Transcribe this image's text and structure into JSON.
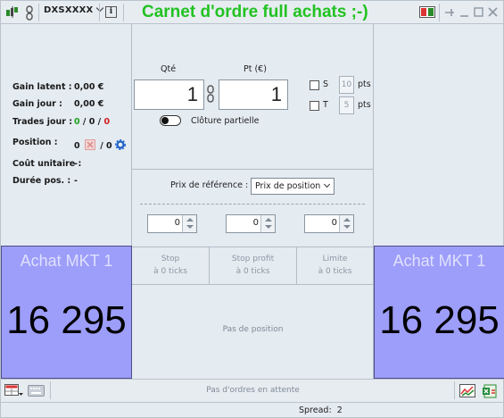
{
  "header": {
    "instrument": "DXSXXXX",
    "title": "Carnet d'ordre full achats ;-)",
    "info_glyph": "i",
    "icons": [
      "chart-icon",
      "link-icon",
      "info-icon",
      "layout-icon",
      "pin-icon",
      "minimize-icon",
      "maximize-icon",
      "close-icon"
    ]
  },
  "stats": [
    {
      "label": "Gain latent :",
      "value": "0,00 €"
    },
    {
      "label": "Gain jour :",
      "value": "0,00 €"
    },
    {
      "label": "Trades jour :",
      "value_a": "0",
      "value_b": "0",
      "value_c": "0"
    },
    {
      "label": "Position :",
      "value": "0",
      "value_b": "0"
    },
    {
      "label": "Coût unitaire :",
      "value": "-"
    },
    {
      "label": "Durée pos. :",
      "value": "-"
    }
  ],
  "order_entry": {
    "qty_label": "Qté",
    "qty_value": "1",
    "pt_label": "Pt (€)",
    "pt_value": "1",
    "s_label": "S",
    "s_pts": "10",
    "t_label": "T",
    "t_pts": "5",
    "pts_unit": "pts",
    "partial_close_label": "Clôture partielle"
  },
  "reference": {
    "label": "Prix de référence :",
    "selected": "Prix de position"
  },
  "spinners": [
    "0",
    "0",
    "0"
  ],
  "sub_headers": [
    {
      "line1": "Stop",
      "line2": "à 0 ticks"
    },
    {
      "line1": "Stop profit",
      "line2": "à 0 ticks"
    },
    {
      "line1": "Limite",
      "line2": "à 0 ticks"
    }
  ],
  "no_position_text": "Pas de position",
  "buy_left": {
    "caption": "Achat MKT 1",
    "price": "16 295"
  },
  "buy_right": {
    "caption": "Achat MKT 1",
    "price": "16 295"
  },
  "pending_text": "Pas d'ordres en attente",
  "status": {
    "spread_label": "Spread:",
    "spread_value": "2"
  },
  "colors": {
    "title_green": "#22c222",
    "buy_panel": "#9d9dfa",
    "win_green": "#1fa01f",
    "loss_red": "#d02020"
  }
}
